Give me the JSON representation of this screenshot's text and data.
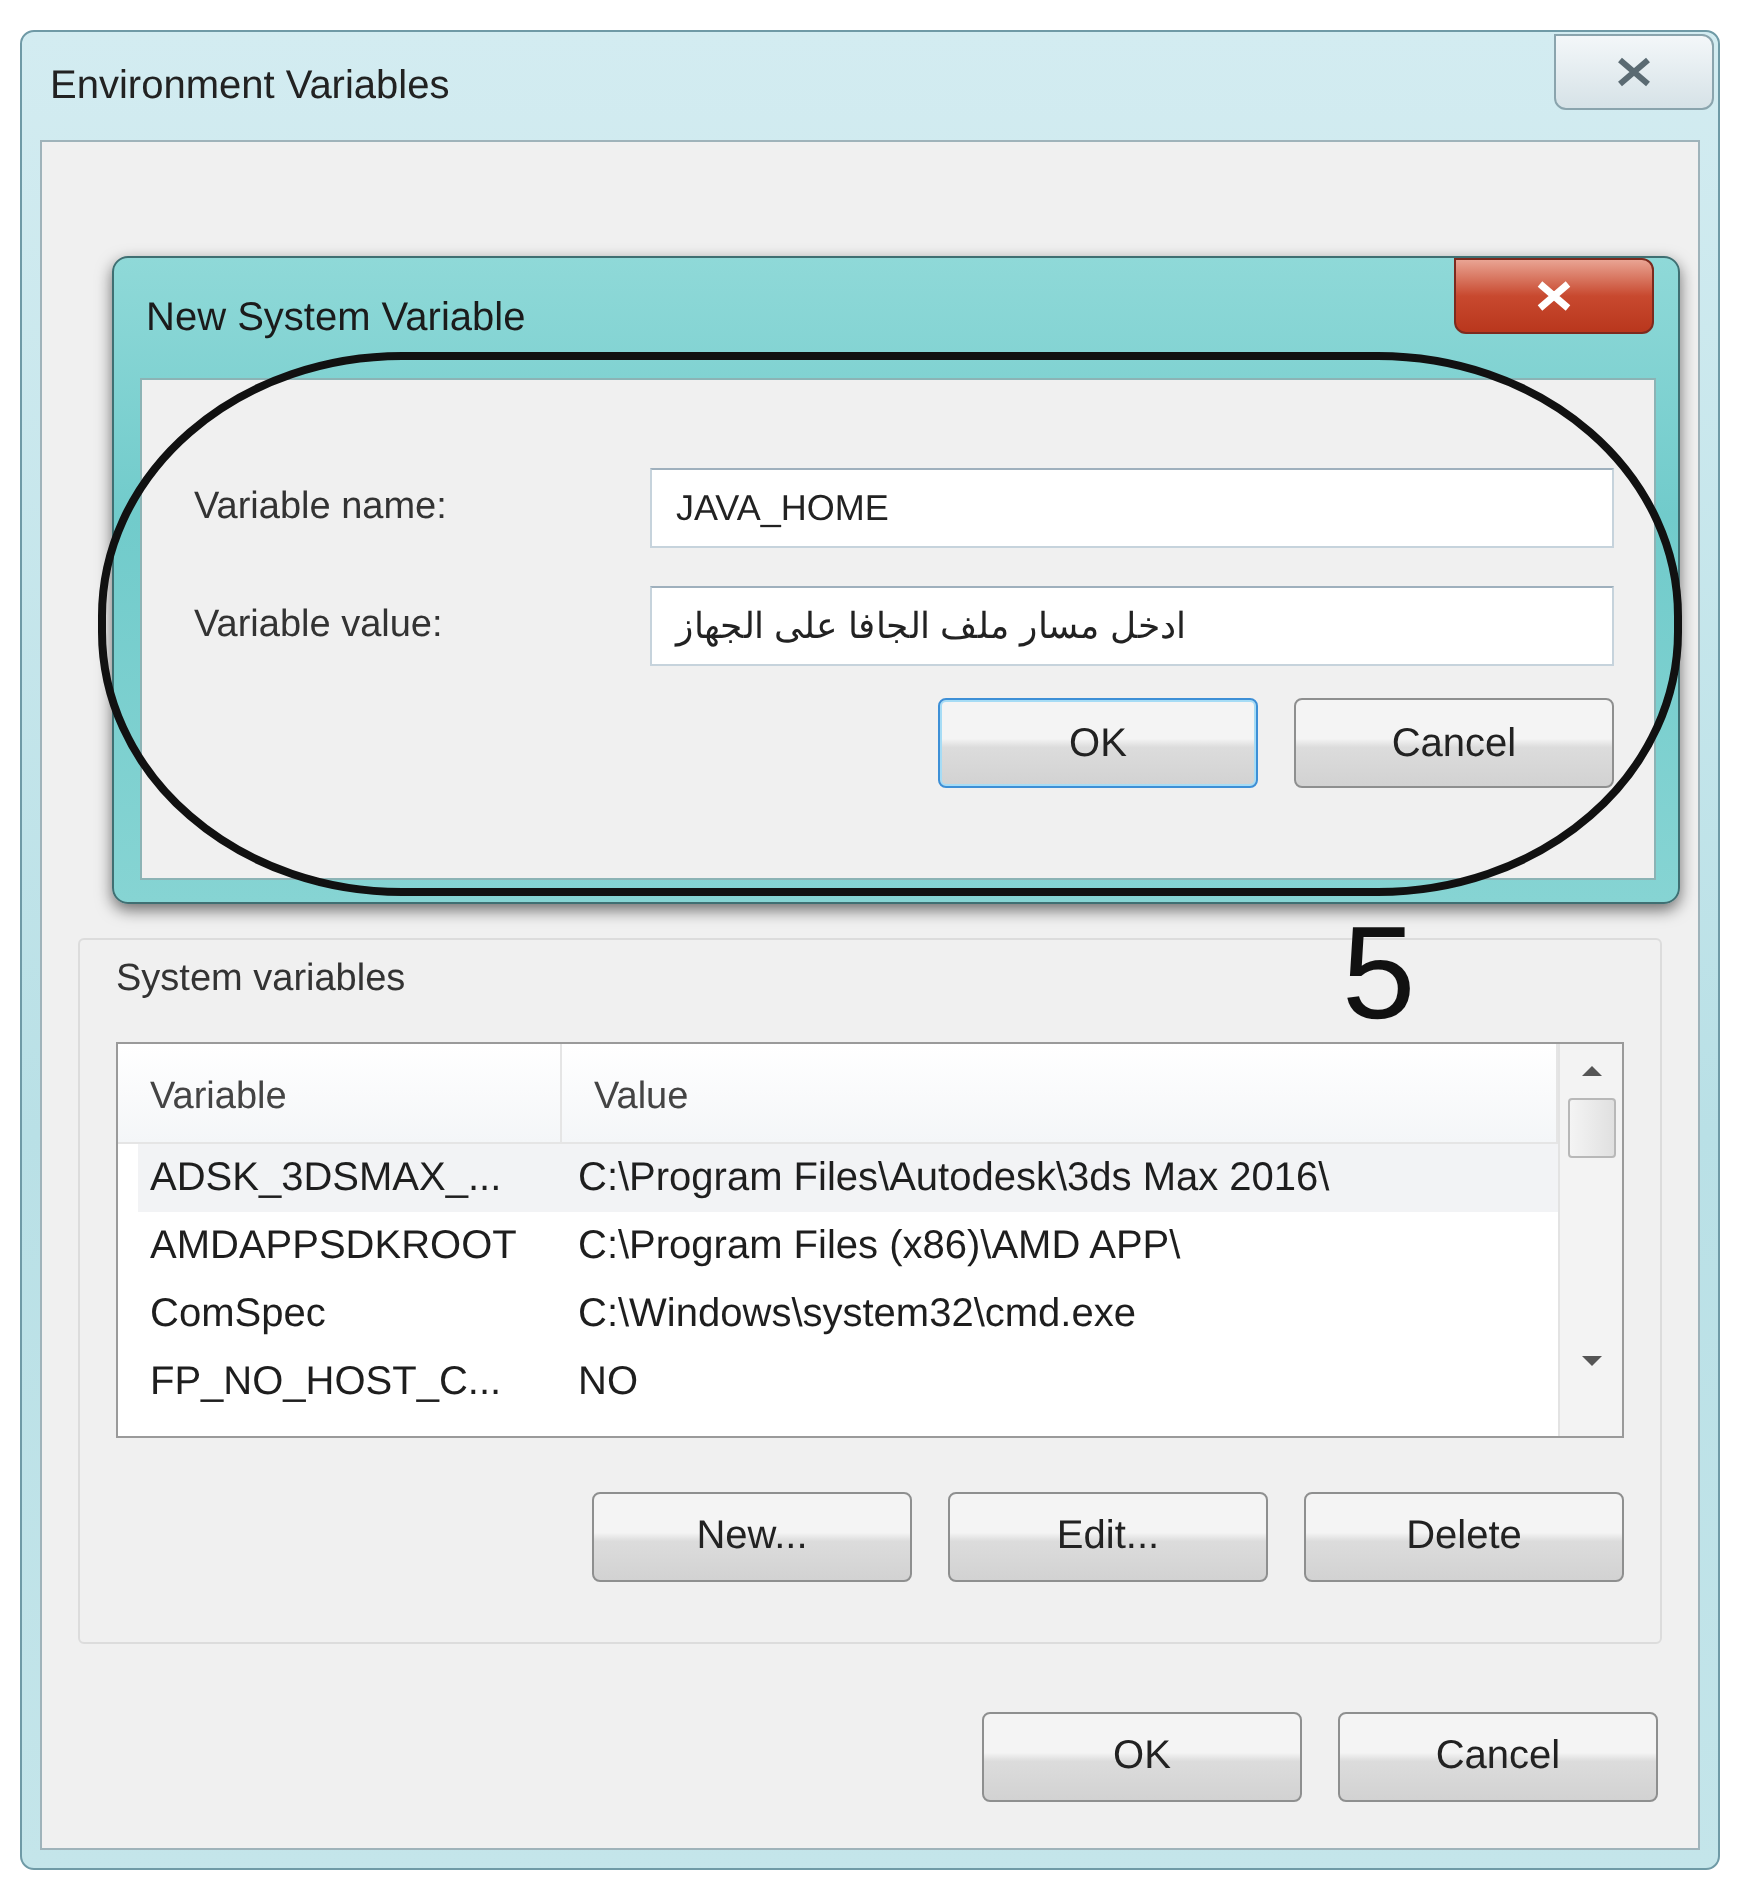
{
  "window": {
    "title": "Environment Variables"
  },
  "dialog": {
    "title": "New System Variable",
    "fields": [
      {
        "label": "Variable name:",
        "value": "JAVA_HOME"
      },
      {
        "label": "Variable value:",
        "value": "ادخل مسار ملف الجافا على الجهاز"
      }
    ],
    "buttons": [
      {
        "label": "OK",
        "default": true
      },
      {
        "label": "Cancel",
        "default": false
      }
    ]
  },
  "system_variables": {
    "label": "System variables",
    "columns": [
      "Variable",
      "Value"
    ],
    "rows": [
      {
        "variable": "ADSK_3DSMAX_...",
        "value": "C:\\Program Files\\Autodesk\\3ds Max 2016\\",
        "selected": true
      },
      {
        "variable": "AMDAPPSDKROOT",
        "value": "C:\\Program Files (x86)\\AMD APP\\",
        "selected": false
      },
      {
        "variable": "ComSpec",
        "value": "C:\\Windows\\system32\\cmd.exe",
        "selected": false
      },
      {
        "variable": "FP_NO_HOST_C...",
        "value": "NO",
        "selected": false
      }
    ],
    "buttons": [
      "New...",
      "Edit...",
      "Delete"
    ]
  },
  "footer_buttons": [
    "OK",
    "Cancel"
  ],
  "annotation": {
    "step": "5"
  }
}
